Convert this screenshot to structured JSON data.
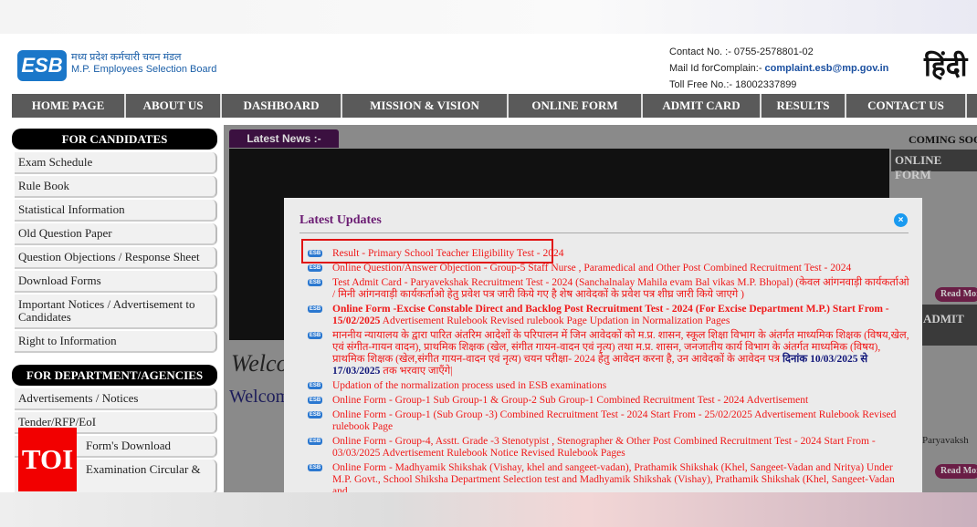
{
  "header": {
    "logo": "ESB",
    "org_hindi": "मध्य प्रदेश कर्मचारी चयन मंडल",
    "org_english": "M.P. Employees Selection Board",
    "contact": "Contact No. :- 0755-2578801-02",
    "mail_label": "Mail Id forComplain:-",
    "mail": "complaint.esb@mp.gov.in",
    "tollfree": "Toll Free No.:- 18002337899",
    "hindi_toggle": "हिंदी"
  },
  "nav": [
    "HOME PAGE",
    "ABOUT US",
    "DASHBOARD",
    "MISSION & VISION",
    "ONLINE FORM",
    "ADMIT CARD",
    "RESULTS",
    "CONTACT US"
  ],
  "sidebar": {
    "candidates_title": "FOR CANDIDATES",
    "candidates": [
      "Exam Schedule",
      "Rule Book",
      "Statistical Information",
      "Old Question Paper",
      "Question Objections / Response Sheet",
      "Download Forms",
      "Important Notices / Advertisement to Candidates",
      "Right to Information"
    ],
    "dept_title": "FOR DEPARTMENT/AGENCIES",
    "dept": [
      "Advertisements / Notices",
      "Tender/RFP/EoI",
      "Form's Download",
      "Examination Circular &"
    ]
  },
  "main": {
    "latest_news": "Latest News :-",
    "coming_soon": "COMING SOON",
    "online_form": "ONLINE FORM",
    "admit": "ADMIT",
    "read_more": "Read More",
    "welcome_script": "Welco",
    "welcome": "Welcom",
    "side_text": "Paryavaksh"
  },
  "modal": {
    "title": "Latest Updates",
    "close": "×",
    "items": [
      "Result - Primary School Teacher Eligibility Test - 2024",
      "Online Question/Answer Objection - Group-5 Staff Nurse , Paramedical and Other Post Combined Recruitment Test - 2024",
      "Test Admit Card  - Paryavekshak Recruitment Test - 2024 (Sanchalnalay Mahila evam Bal vikas M.P. Bhopal) (केवल आंगनवाड़ी कार्यकर्ताओ / मिनी आंगनवाड़ी कार्यकर्ताओ हेतु प्रवेश पत्र जारी किये गए है शेष आवेदकों के प्रवेश पत्र शीघ्र जारी किये जाएगे )",
      "Online Form -Excise Constable Direct and Backlog Post Recruitment Test - 2024 (For Excise Department M.P.) Start From - 15/02/2025",
      "माननीय न्यायालय के द्वारा पारित अंतरिम आदेशों के परिपालन में जिन आवेदकों को म.प्र. शासन, स्कूल शिक्षा विभाग के अंतर्गत माध्यमिक शिक्षक (विषय,खेल, एवं संगीत-गायन वादन), प्राथमिक शिक्षक (खेल, संगीत गायन-वादन एवं नृत्य) तथा म.प्र. शासन, जनजातीय कार्य विभाग के अंतर्गत माध्यमिक (विषय), प्राथमिक शिक्षक (खेल,संगीत गायन-वादन एवं नृत्य) चयन परीक्षा- 2024 हेतु आवेदन करना है, उन आवेदकों के आवेदन पत्र",
      "Updation of the normalization process used in ESB examinations",
      "Online Form - Group-1 Sub Group-1 & Group-2 Sub Group-1 Combined Recruitment Test - 2024  Advertisement",
      "Online Form - Group-1 (Sub Group -3) Combined Recruitment Test - 2024 Start From - 25/02/2025 Advertisement   Rulebook    Revised rulebook Page",
      "Online Form - Group-4, Asstt. Grade -3 Stenotypist , Stenographer & Other Post Combined Recruitment Test - 2024 Start From - 03/03/2025  Advertisement     Rulebook   Notice    Revised Rulebook Pages",
      "Online Form - Madhyamik Shikshak (Vishay, khel and sangeet-vadan), Prathamik Shikshak (Khel, Sangeet-Vadan and Nritya)  Under M.P. Govt., School Shiksha Department Selection test and Madhyamik Shikshak (Vishay), Prathamik Shikshak (Khel, Sangeet-Vadan and"
    ],
    "excise_links": "Advertisement   Rulebook    Revised rulebook Page   Updation in Normalization Pages",
    "date_blue": "दिनांक 10/03/2025 से 17/03/2025",
    "date_tail": "तक भरवाए जाएँगे|"
  },
  "watermark": "TOI"
}
